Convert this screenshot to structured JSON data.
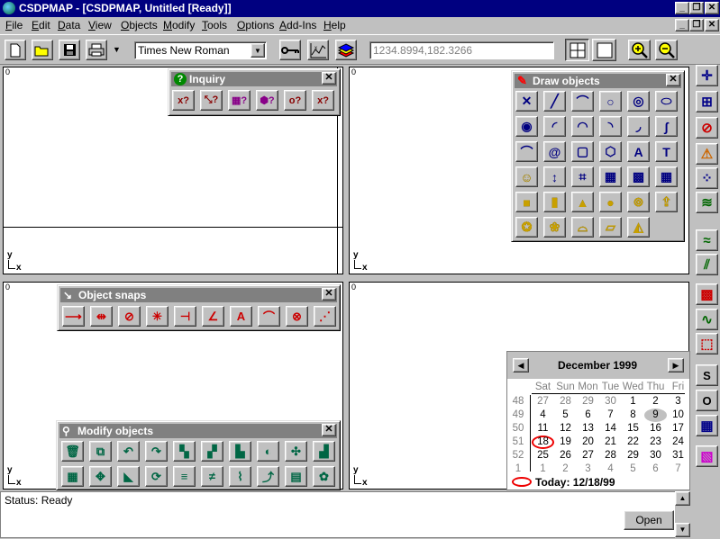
{
  "titlebar": {
    "title": "CSDPMAP - [CSDPMAP, Untitled [Ready]]",
    "minimize": "_",
    "restore": "❐",
    "close": "✕"
  },
  "menubar": {
    "items": [
      "File",
      "Edit",
      "Data",
      "View",
      "Objects",
      "Modify",
      "Tools",
      "Options",
      "Add-Ins",
      "Help"
    ],
    "mdi_minimize": "_",
    "mdi_restore": "❐",
    "mdi_close": "✕"
  },
  "toolbar": {
    "font_value": "Times New Roman",
    "coordinates": "1234.8994,182.3266"
  },
  "viewports": {
    "origin_label": "0",
    "axis_y": "y",
    "axis_x": "x"
  },
  "inquiry": {
    "title": "Inquiry",
    "buttons": [
      "x?",
      "⤡?",
      "▦?",
      "⬢?",
      "o?",
      "x?"
    ]
  },
  "draw_objects": {
    "title": "Draw objects"
  },
  "object_snaps": {
    "title": "Object snaps"
  },
  "modify_objects": {
    "title": "Modify objects"
  },
  "right_toolbar": {
    "s_label": "S",
    "o_label": "O"
  },
  "calendar": {
    "month": "December 1999",
    "weekdays": [
      "Sat",
      "Sun",
      "Mon",
      "Tue",
      "Wed",
      "Thu",
      "Fri"
    ],
    "weeks": [
      {
        "num": "48",
        "days": [
          "27",
          "28",
          "29",
          "30",
          "1",
          "2",
          "3"
        ]
      },
      {
        "num": "49",
        "days": [
          "4",
          "5",
          "6",
          "7",
          "8",
          "9",
          "10"
        ]
      },
      {
        "num": "50",
        "days": [
          "11",
          "12",
          "13",
          "14",
          "15",
          "16",
          "17"
        ]
      },
      {
        "num": "51",
        "days": [
          "18",
          "19",
          "20",
          "21",
          "22",
          "23",
          "24"
        ]
      },
      {
        "num": "52",
        "days": [
          "25",
          "26",
          "27",
          "28",
          "29",
          "30",
          "31"
        ]
      },
      {
        "num": "1",
        "days": [
          "1",
          "2",
          "3",
          "4",
          "5",
          "6",
          "7"
        ]
      }
    ],
    "today_label": "Today: 12/18/99",
    "selected_day": "18",
    "highlight_day": "9"
  },
  "status": {
    "text": "Status: Ready",
    "open_button": "Open"
  }
}
